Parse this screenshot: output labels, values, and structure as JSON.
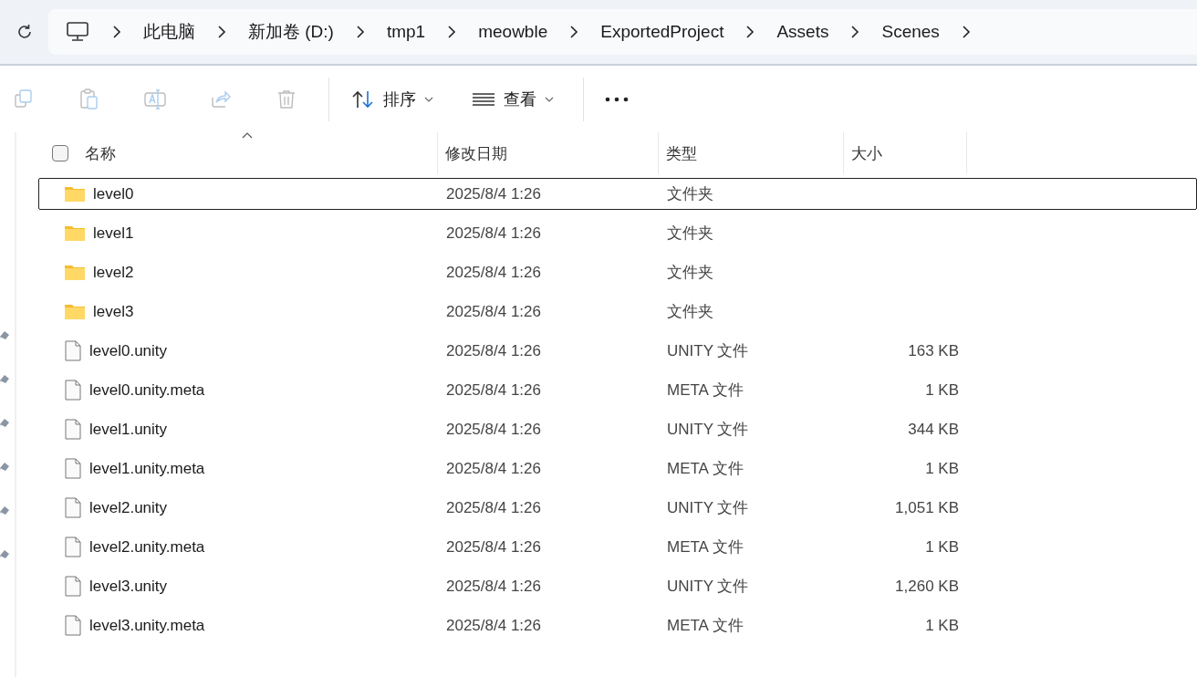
{
  "address_bar": {
    "breadcrumbs": [
      {
        "label": "此电脑"
      },
      {
        "label": "新加卷 (D:)"
      },
      {
        "label": "tmp1"
      },
      {
        "label": "meowble"
      },
      {
        "label": "ExportedProject"
      },
      {
        "label": "Assets"
      },
      {
        "label": "Scenes"
      }
    ]
  },
  "toolbar": {
    "items": [
      {
        "kind": "copy",
        "disabled": true
      },
      {
        "kind": "paste",
        "disabled": true
      },
      {
        "kind": "rename",
        "disabled": true
      },
      {
        "kind": "share",
        "disabled": true
      },
      {
        "kind": "delete",
        "disabled": true
      },
      {
        "kind": "sort",
        "label": "排序"
      },
      {
        "kind": "view",
        "label": "查看"
      },
      {
        "kind": "more"
      }
    ]
  },
  "file_list": {
    "select_all": {
      "checked": false
    },
    "columns": [
      {
        "label": "名称",
        "sorted": true
      },
      {
        "label": "修改日期",
        "sorted": false
      },
      {
        "label": "类型",
        "sorted": false
      },
      {
        "label": "大小",
        "sorted": false
      }
    ],
    "rows": [
      {
        "kind": "folder",
        "name": "level0",
        "modified": "2025/8/4 1:26",
        "type": "文件夹",
        "selected": true
      },
      {
        "kind": "folder",
        "name": "level1",
        "modified": "2025/8/4 1:26",
        "type": "文件夹",
        "selected": false
      },
      {
        "kind": "folder",
        "name": "level2",
        "modified": "2025/8/4 1:26",
        "type": "文件夹",
        "selected": false
      },
      {
        "kind": "folder",
        "name": "level3",
        "modified": "2025/8/4 1:26",
        "type": "文件夹",
        "selected": false
      },
      {
        "kind": "file",
        "name": "level0.unity",
        "modified": "2025/8/4 1:26",
        "type": "UNITY 文件",
        "size": "163 KB",
        "selected": false
      },
      {
        "kind": "file",
        "name": "level0.unity.meta",
        "modified": "2025/8/4 1:26",
        "type": "META 文件",
        "size": "1 KB",
        "selected": false
      },
      {
        "kind": "file",
        "name": "level1.unity",
        "modified": "2025/8/4 1:26",
        "type": "UNITY 文件",
        "size": "344 KB",
        "selected": false
      },
      {
        "kind": "file",
        "name": "level1.unity.meta",
        "modified": "2025/8/4 1:26",
        "type": "META 文件",
        "size": "1 KB",
        "selected": false
      },
      {
        "kind": "file",
        "name": "level2.unity",
        "modified": "2025/8/4 1:26",
        "type": "UNITY 文件",
        "size": "1,051 KB",
        "selected": false
      },
      {
        "kind": "file",
        "name": "level2.unity.meta",
        "modified": "2025/8/4 1:26",
        "type": "META 文件",
        "size": "1 KB",
        "selected": false
      },
      {
        "kind": "file",
        "name": "level3.unity",
        "modified": "2025/8/4 1:26",
        "type": "UNITY 文件",
        "size": "1,260 KB",
        "selected": false
      },
      {
        "kind": "file",
        "name": "level3.unity.meta",
        "modified": "2025/8/4 1:26",
        "type": "META 文件",
        "size": "1 KB",
        "selected": false
      }
    ]
  }
}
